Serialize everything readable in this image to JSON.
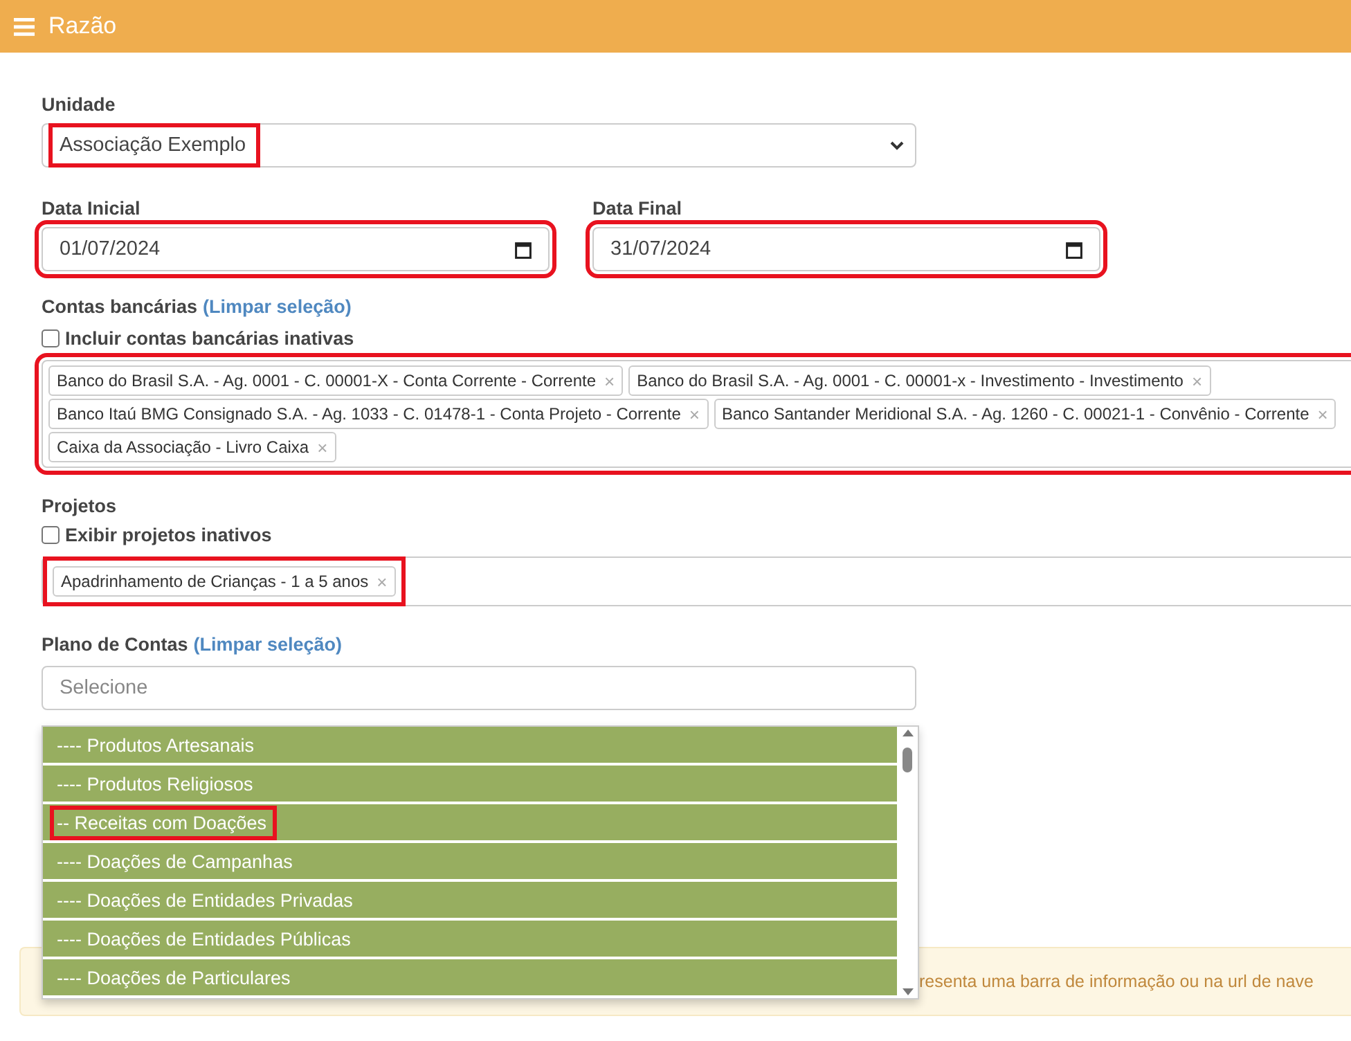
{
  "header": {
    "title": "Razão"
  },
  "unidade": {
    "label": "Unidade",
    "value": "Associação Exemplo",
    "highlighted": true
  },
  "dates": [
    {
      "label": "Data Inicial",
      "value": "01/07/2024",
      "highlighted": true
    },
    {
      "label": "Data Final",
      "value": "31/07/2024",
      "highlighted": true
    }
  ],
  "contas": {
    "label": "Contas bancárias",
    "clear_link": "(Limpar seleção)",
    "checkbox": {
      "label": "Incluir contas bancárias inativas",
      "checked": false
    },
    "highlighted": true,
    "tags": [
      {
        "label": "Banco do Brasil S.A. - Ag. 0001 - C. 00001-X - Conta Corrente - Corrente",
        "remove": "×"
      },
      {
        "label": "Banco do Brasil S.A. - Ag. 0001 - C. 00001-x - Investimento - Investimento",
        "remove": "×"
      },
      {
        "label": "Banco Itaú BMG Consignado S.A. - Ag. 1033 - C. 01478-1 - Conta Projeto - Corrente",
        "remove": "×"
      },
      {
        "label": "Banco Santander Meridional S.A. - Ag. 1260 - C. 00021-1 - Convênio - Corrente",
        "remove": "×"
      },
      {
        "label": "Caixa da Associação - Livro Caixa",
        "remove": "×"
      }
    ]
  },
  "projetos": {
    "label": "Projetos",
    "checkbox": {
      "label": "Exibir projetos inativos",
      "checked": false
    },
    "tags": [
      {
        "label": "Apadrinhamento de Crianças - 1 a 5 anos",
        "remove": "×",
        "highlighted": true
      }
    ]
  },
  "plano": {
    "label": "Plano de Contas",
    "clear_link": "(Limpar seleção)",
    "placeholder": "Selecione",
    "options": [
      {
        "label": "---- Produtos Artesanais",
        "highlighted": false
      },
      {
        "label": "---- Produtos Religiosos",
        "highlighted": false
      },
      {
        "label": "-- Receitas com Doações",
        "highlighted": true
      },
      {
        "label": "---- Doações de Campanhas",
        "highlighted": false
      },
      {
        "label": "---- Doações de Entidades Privadas",
        "highlighted": false
      },
      {
        "label": "---- Doações de Entidades Públicas",
        "highlighted": false
      },
      {
        "label": "---- Doações de Particulares",
        "highlighted": false
      }
    ]
  },
  "alert": {
    "text": "resenta uma barra de informação ou na url de nave"
  }
}
